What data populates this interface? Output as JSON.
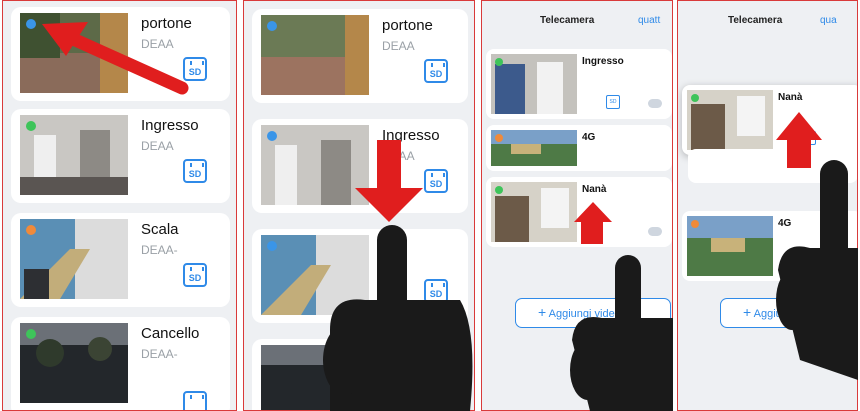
{
  "panel1": {
    "cameras": [
      {
        "name": "portone",
        "sub": "DEAA",
        "sd": "SD",
        "dot_color": "#3a95e8"
      },
      {
        "name": "Ingresso",
        "sub": "DEAA",
        "sd": "SD",
        "dot_color": "#3ec45a"
      },
      {
        "name": "Scala",
        "sub": "DEAA-",
        "sd": "SD",
        "dot_color": "#f08a3a"
      },
      {
        "name": "Cancello",
        "sub": "DEAA-",
        "sd": "SD",
        "dot_color": "#3ec45a"
      }
    ]
  },
  "panel2": {
    "cameras": [
      {
        "name": "portone",
        "sub": "DEAA",
        "sd": "SD",
        "dot_color": "#3a95e8"
      },
      {
        "name": "Ingresso",
        "sub": "DEAA",
        "sd": "SD",
        "dot_color": "#3a95e8"
      },
      {
        "name": "la",
        "sub": "",
        "sd": "SD",
        "dot_color": "#3a95e8"
      },
      {
        "name": "Ca",
        "sub": "",
        "sd": "",
        "dot_color": "#3a95e8"
      }
    ]
  },
  "panel3": {
    "title": "Telecamera",
    "link": "quatt",
    "cameras": [
      {
        "name": "Ingresso",
        "sd": "SD",
        "dot_color": "#3ec45a"
      },
      {
        "name": "4G",
        "sd": "",
        "dot_color": "#f08a3a"
      },
      {
        "name": "Nanà",
        "sd": "",
        "dot_color": "#3ec45a"
      }
    ],
    "add_label": "Aggiungi videoc",
    "add_icon": "+"
  },
  "panel4": {
    "title": "Telecamera",
    "link": "qua",
    "cameras": [
      {
        "name": "Nanà",
        "sd": "SD",
        "dot_color": "#3ec45a"
      },
      {
        "name": "4G",
        "sd": "",
        "dot_color": "#f08a3a"
      }
    ],
    "add_label": "Aggiungi v",
    "add_icon": "+"
  },
  "colors": {
    "accent": "#2f8ae8",
    "frame": "#d93a3a",
    "arrow": "#e01e1e",
    "hand": "#1a1a1a"
  }
}
